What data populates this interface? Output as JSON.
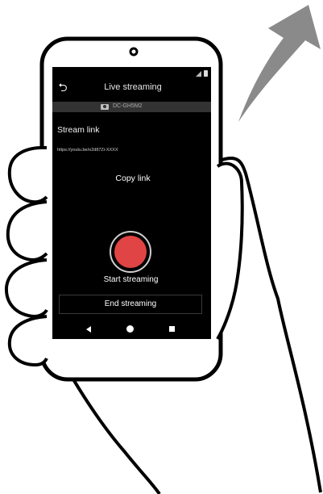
{
  "header": {
    "title": "Live streaming",
    "back_icon": "back-arrow-icon"
  },
  "status_bar": {
    "icons": [
      "signal-icon",
      "battery-icon"
    ]
  },
  "camera": {
    "name": "DC-GH5M2",
    "icon": "camera-icon"
  },
  "stream_link": {
    "heading": "Stream link",
    "url": "https://youtu.be/o2d87Zi-XXXX"
  },
  "buttons": {
    "copy_link": "Copy link",
    "start_streaming": "Start streaming",
    "end_streaming": "End streaming"
  },
  "nav_bar": {
    "icons": [
      "nav-back-icon",
      "nav-home-icon",
      "nav-recent-icon"
    ]
  },
  "colors": {
    "screen_bg": "#000000",
    "record": "#e04444",
    "camera_bar": "#333333"
  }
}
